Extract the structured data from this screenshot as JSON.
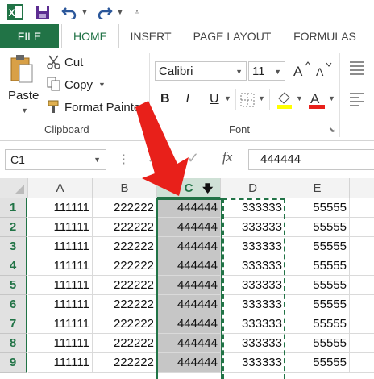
{
  "toolbar": {
    "app_icon": "excel-logo-icon",
    "save_icon": "save-icon",
    "undo_icon": "undo-icon",
    "redo_icon": "redo-icon"
  },
  "tabs": [
    {
      "label": "FILE"
    },
    {
      "label": "HOME"
    },
    {
      "label": "INSERT"
    },
    {
      "label": "PAGE LAYOUT"
    },
    {
      "label": "FORMULAS"
    }
  ],
  "clipboard": {
    "paste_label": "Paste",
    "cut_label": "Cut",
    "copy_label": "Copy",
    "format_painter_label": "Format Painter",
    "group_label": "Clipboard"
  },
  "font": {
    "font_name": "Calibri",
    "font_size": "11",
    "bold": "B",
    "italic": "I",
    "underline": "U",
    "font_color_letter": "A",
    "group_label": "Font"
  },
  "formula_bar": {
    "name_box": "C1",
    "fx_label": "fx",
    "value": "444444"
  },
  "grid": {
    "columns": [
      "A",
      "B",
      "C",
      "D",
      "E"
    ],
    "selected_column": "C",
    "rows": [
      {
        "num": "1",
        "cells": [
          "111111",
          "222222",
          "444444",
          "333333",
          "55555"
        ]
      },
      {
        "num": "2",
        "cells": [
          "111111",
          "222222",
          "444444",
          "333333",
          "55555"
        ]
      },
      {
        "num": "3",
        "cells": [
          "111111",
          "222222",
          "444444",
          "333333",
          "55555"
        ]
      },
      {
        "num": "4",
        "cells": [
          "111111",
          "222222",
          "444444",
          "333333",
          "55555"
        ]
      },
      {
        "num": "5",
        "cells": [
          "111111",
          "222222",
          "444444",
          "333333",
          "55555"
        ]
      },
      {
        "num": "6",
        "cells": [
          "111111",
          "222222",
          "444444",
          "333333",
          "55555"
        ]
      },
      {
        "num": "7",
        "cells": [
          "111111",
          "222222",
          "444444",
          "333333",
          "55555"
        ]
      },
      {
        "num": "8",
        "cells": [
          "111111",
          "222222",
          "444444",
          "333333",
          "55555"
        ]
      },
      {
        "num": "9",
        "cells": [
          "111111",
          "222222",
          "444444",
          "333333",
          "55555"
        ]
      }
    ]
  },
  "colors": {
    "excel_green": "#217346",
    "annotation_arrow": "#e8201a",
    "selected_column_fill": "#c6c6c6"
  }
}
